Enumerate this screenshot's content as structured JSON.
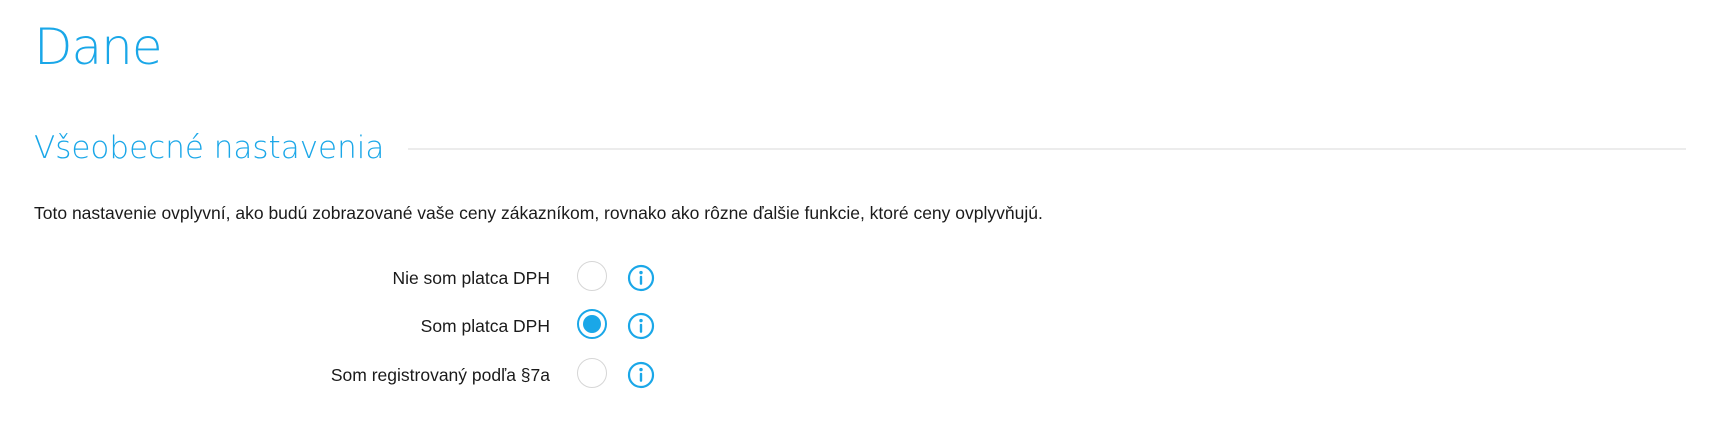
{
  "page": {
    "title": "Dane"
  },
  "section": {
    "title": "Všeobecné nastavenia",
    "description": "Toto nastavenie ovplyvní, ako budú zobrazované vaše ceny zákazníkom, rovnako ako rôzne ďalšie funkcie, ktoré ceny ovplyvňujú."
  },
  "vat_options": [
    {
      "label": "Nie som platca DPH",
      "selected": false,
      "icon": "info-icon"
    },
    {
      "label": "Som platca DPH",
      "selected": true,
      "icon": "info-icon"
    },
    {
      "label": "Som registrovaný podľa §7a",
      "selected": false,
      "icon": "info-icon"
    }
  ],
  "colors": {
    "accent": "#1aa7e8",
    "text": "#1a1a1a",
    "radio_border": "#d6d6d6",
    "divider": "#ececec"
  }
}
